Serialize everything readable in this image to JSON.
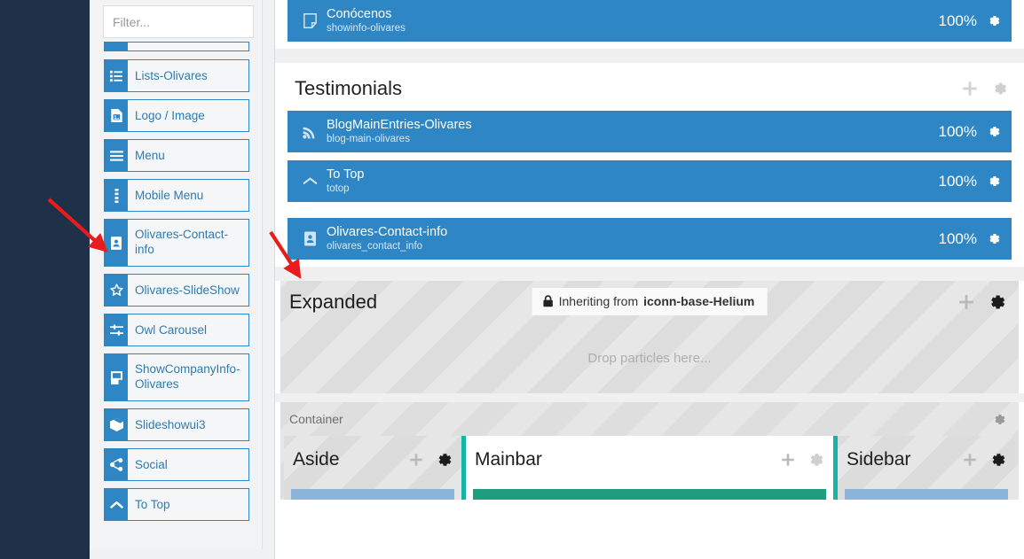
{
  "picker": {
    "filter_placeholder": "Filter...",
    "filter_value": "",
    "search_icon": "search-icon",
    "items": [
      {
        "label": "",
        "icon": "cut-off-item",
        "cut": true
      },
      {
        "label": "Lists-Olivares",
        "icon": "list-icon"
      },
      {
        "label": "Logo / Image",
        "icon": "image-file-icon"
      },
      {
        "label": "Menu",
        "icon": "hamburger-icon"
      },
      {
        "label": "Mobile Menu",
        "icon": "dots-vertical-icon"
      },
      {
        "label": "Olivares-Contact-info",
        "icon": "contact-card-icon",
        "tall": true
      },
      {
        "label": "Olivares-SlideShow",
        "icon": "star-icon"
      },
      {
        "label": "Owl Carousel",
        "icon": "sliders-icon"
      },
      {
        "label": "ShowCompanyInfo-Olivares",
        "icon": "note-icon",
        "tall": true
      },
      {
        "label": "Slideshowui3",
        "icon": "box-icon"
      },
      {
        "label": "Social",
        "icon": "share-icon"
      },
      {
        "label": "To Top",
        "icon": "chevron-up-icon"
      }
    ]
  },
  "canvas": {
    "top_particle": {
      "title": "Conócenos",
      "subtitle": "showinfo-olivares",
      "percent": "100%",
      "icon": "note-icon",
      "gear_icon": "gear-icon"
    },
    "testimonials": {
      "title": "Testimonials",
      "add_icon": "plus-icon",
      "gear_icon": "gear-icon",
      "particles": [
        {
          "title": "BlogMainEntries-Olivares",
          "subtitle": "blog-main-olivares",
          "percent": "100%",
          "icon": "rss-icon",
          "gear_icon": "gear-icon"
        },
        {
          "title": "To Top",
          "subtitle": "totop",
          "percent": "100%",
          "icon": "chevron-up-icon",
          "gear_icon": "gear-icon"
        },
        {
          "title": "Olivares-Contact-info",
          "subtitle": "olivares_contact_info",
          "percent": "100%",
          "icon": "contact-card-icon",
          "gear_icon": "gear-icon"
        }
      ]
    },
    "expanded": {
      "title": "Expanded",
      "inherit_lock_icon": "lock-icon",
      "inherit_prefix": "Inheriting from ",
      "inherit_source": "iconn-base-Helium",
      "drop_hint": "Drop particles here...",
      "add_icon": "plus-icon",
      "gear_icon": "gear-icon"
    },
    "container": {
      "label": "Container",
      "gear_icon": "gear-icon",
      "columns": [
        {
          "title": "Aside",
          "add_icon": "plus-icon",
          "gear_icon": "gear-icon",
          "stub": "blue"
        },
        {
          "title": "Mainbar",
          "add_icon": "plus-icon",
          "gear_icon": "gear-icon",
          "stub": "teal"
        },
        {
          "title": "Sidebar",
          "add_icon": "plus-icon",
          "gear_icon": "gear-icon",
          "stub": "blue"
        }
      ]
    }
  },
  "annotations": {
    "arrow_color": "#e81c1c",
    "arrows": [
      {
        "name": "arrow-to-sidebar-contact-item"
      },
      {
        "name": "arrow-to-canvas-contact-particle"
      }
    ]
  },
  "colors": {
    "navy_rail": "#1e3149",
    "particle_blue": "#2e87c4",
    "accent_teal": "#15b5a6",
    "panel_bg": "#f2f3f4"
  }
}
